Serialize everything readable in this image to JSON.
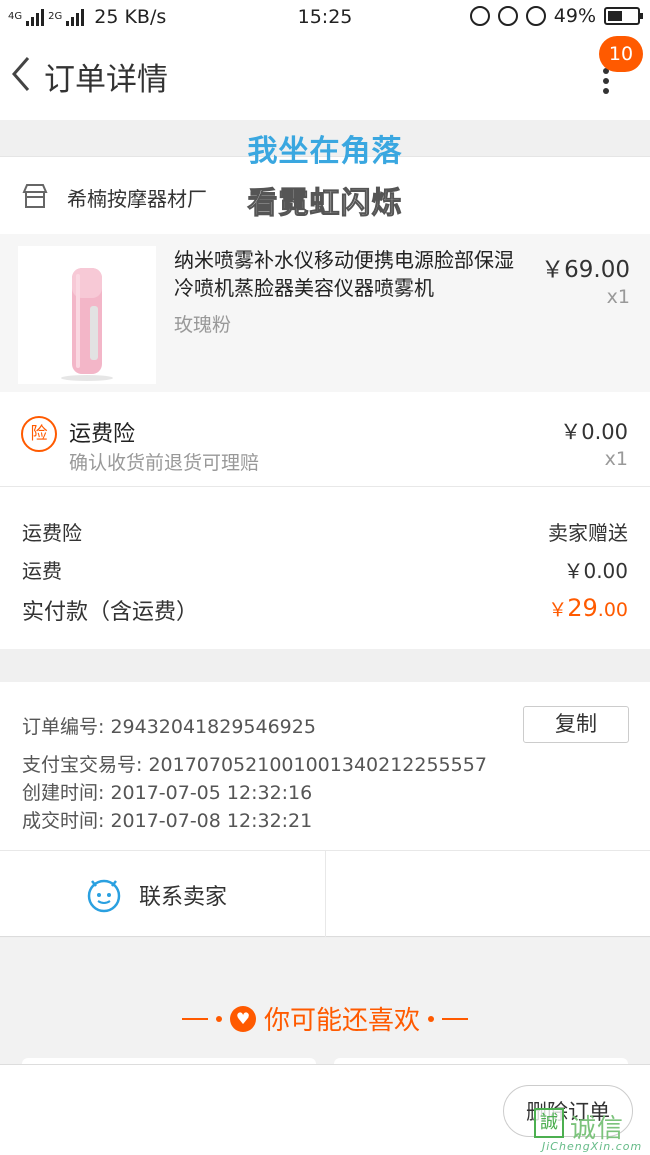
{
  "status_bar": {
    "net_labels": [
      "4G",
      "2G"
    ],
    "speed": "25 KB/s",
    "time": "15:25",
    "battery": "49%",
    "battery_level": 0.49
  },
  "nav": {
    "title": "订单详情",
    "badge": "10"
  },
  "overlay": {
    "line1": "我坐在角落",
    "line2": "看霓虹闪烁"
  },
  "shop": {
    "name": "希楠按摩器材厂"
  },
  "product": {
    "title": "纳米喷雾补水仪移动便携电源脸部保湿冷喷机蒸脸器美容仪器喷雾机",
    "sku": "玫瑰粉",
    "price": "￥69.00",
    "qty": "x1"
  },
  "insurance": {
    "icon_text": "险",
    "title": "运费险",
    "desc": "确认收货前退货可理赔",
    "price": "￥0.00",
    "qty": "x1"
  },
  "summary": {
    "rows": [
      {
        "label": "运费险",
        "value": "卖家赠送"
      },
      {
        "label": "运费",
        "value": "￥0.00"
      }
    ],
    "total_label": "实付款（含运费）",
    "total_currency": "￥",
    "total_int": "29",
    "total_dec": ".00"
  },
  "order_info": {
    "lines": [
      "订单编号:   29432041829546925",
      "支付宝交易号:   2017070521001001340212255557",
      "创建时间:   2017-07-05 12:32:16",
      "成交时间:   2017-07-08 12:32:21"
    ],
    "copy_label": "复制"
  },
  "contact": {
    "label": "联系卖家"
  },
  "recommend": {
    "title": "你可能还喜欢"
  },
  "bottom": {
    "delete_label": "删除订单"
  },
  "watermark": {
    "char": "誠",
    "text": "诚信",
    "url": "JiChengXin.com"
  },
  "colors": {
    "accent": "#ff5a00",
    "overlay_blue": "#3aa7e0",
    "contact_blue": "#2aa0e0"
  }
}
